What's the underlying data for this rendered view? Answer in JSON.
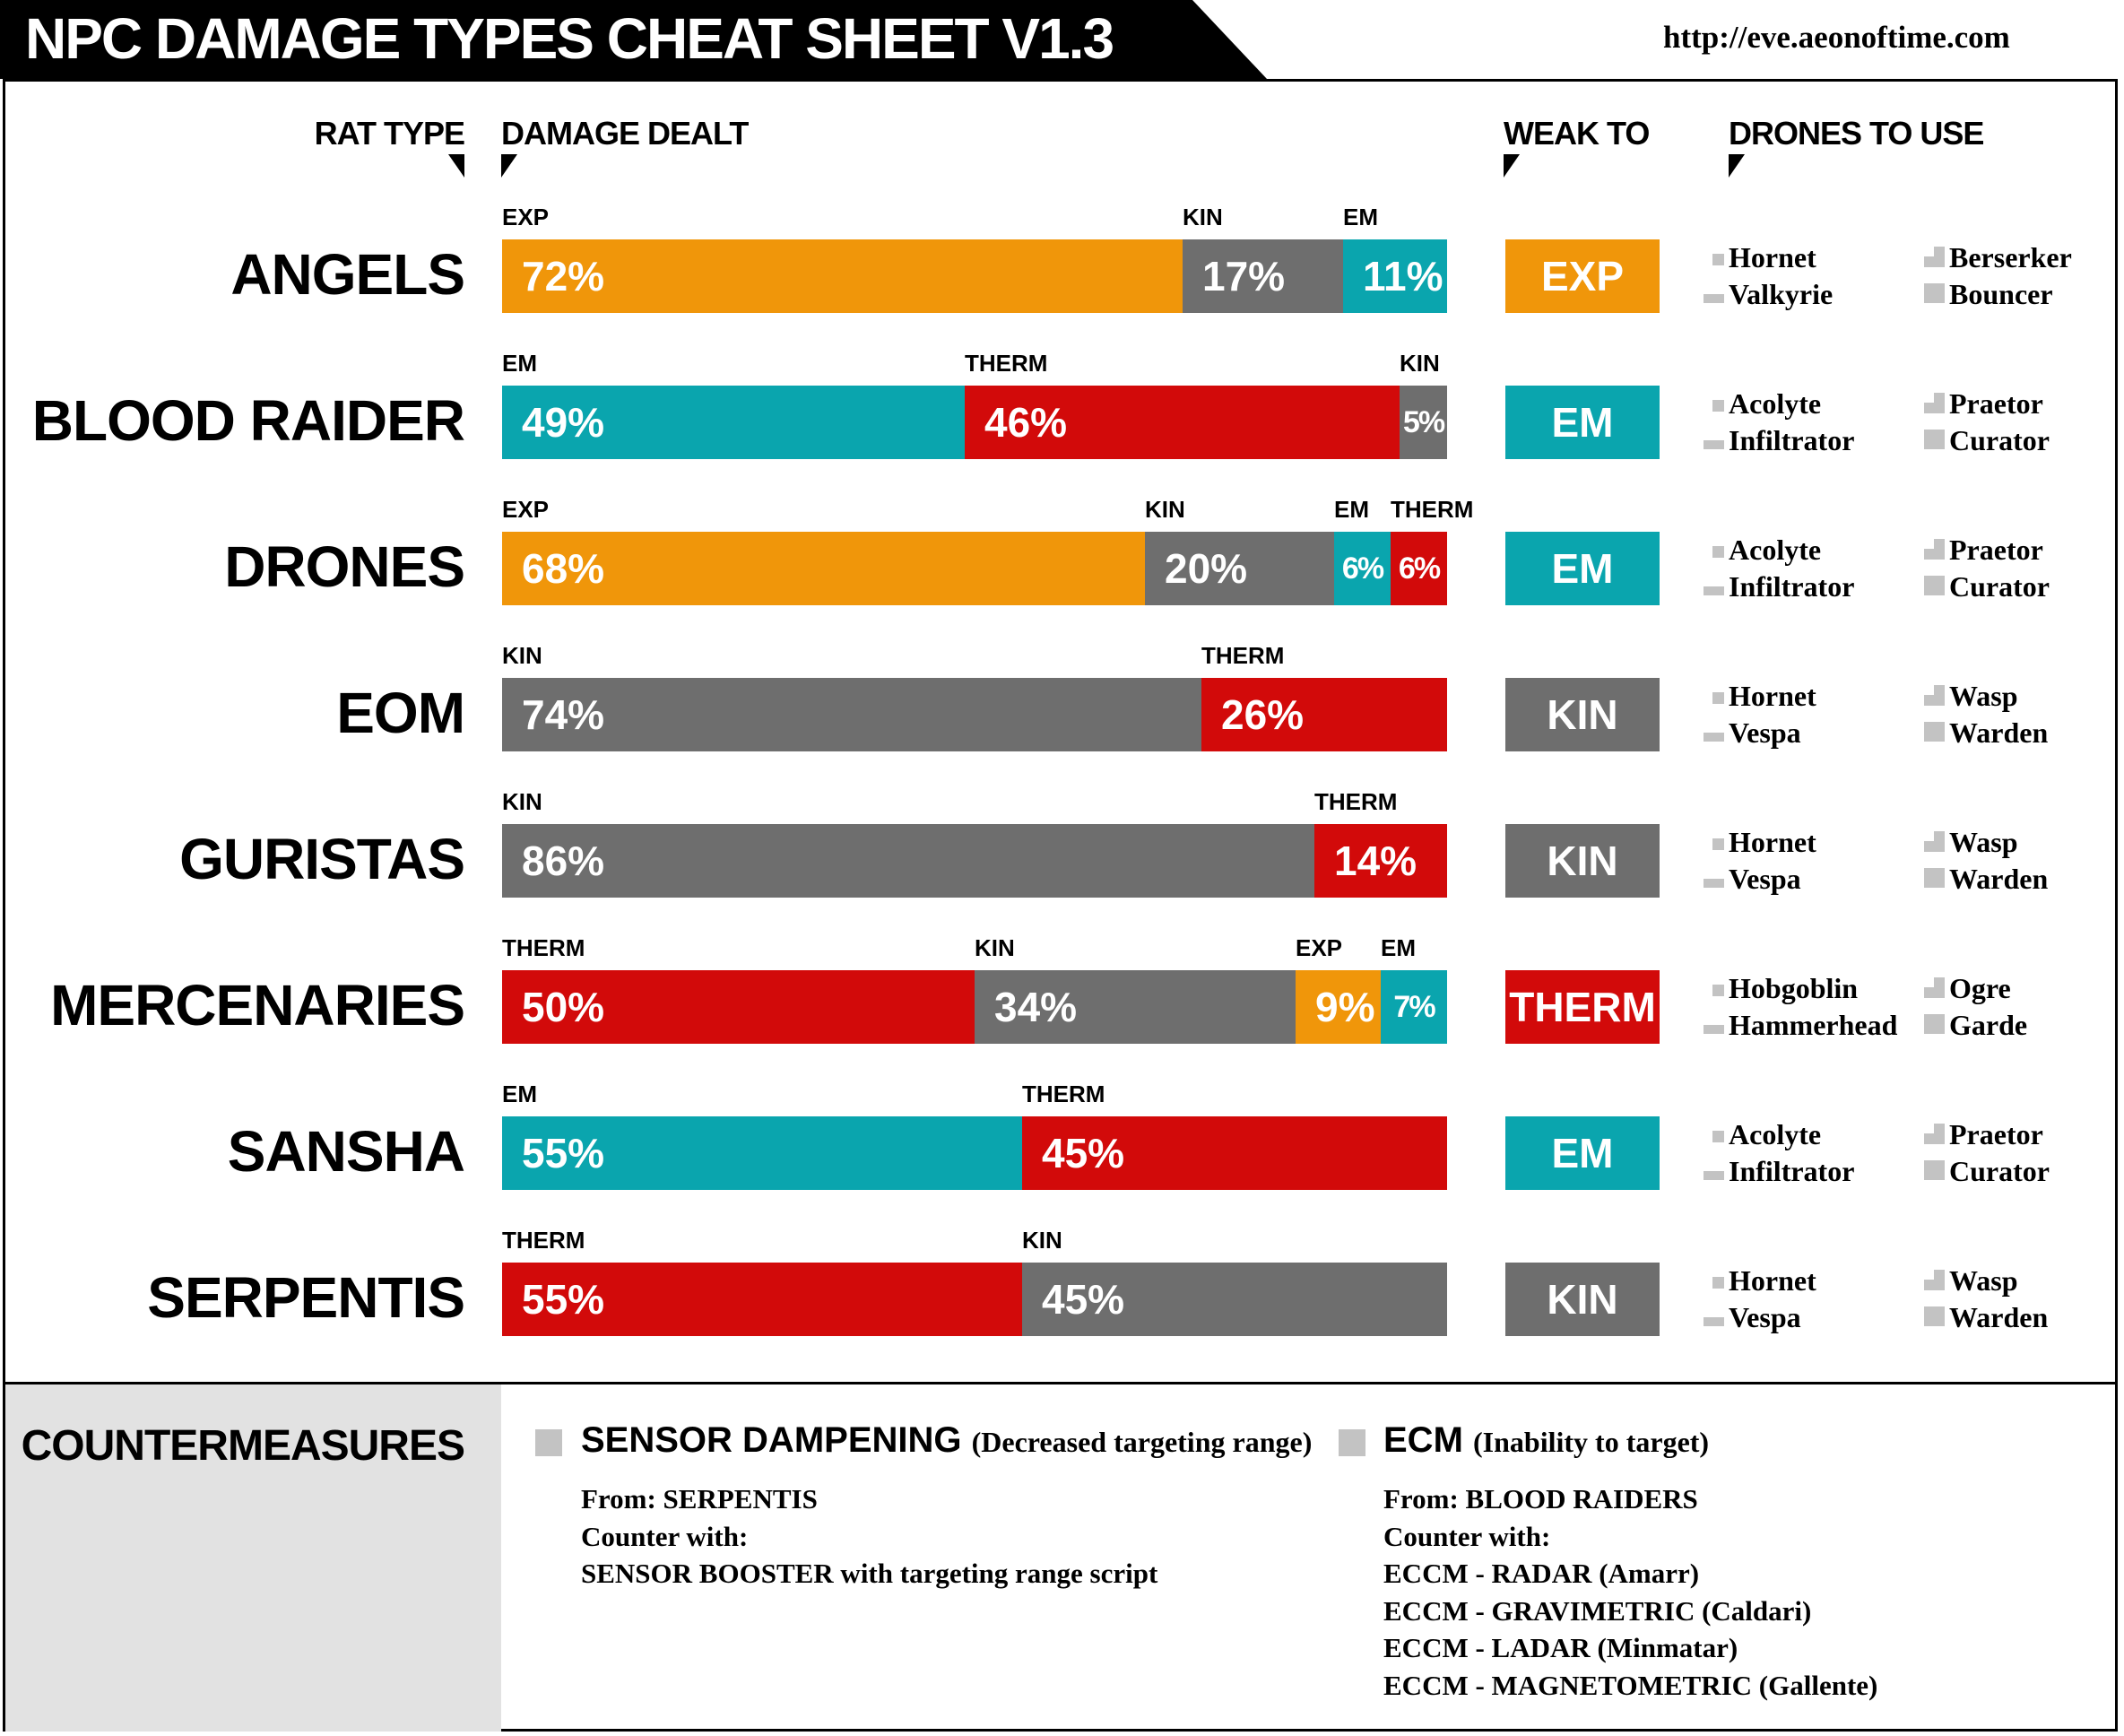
{
  "header": {
    "title": "NPC DAMAGE TYPES CHEAT SHEET V1.3",
    "url": "http://eve.aeonoftime.com"
  },
  "columns": {
    "rat_type": "RAT TYPE",
    "damage_dealt": "DAMAGE DEALT",
    "weak_to": "WEAK TO",
    "drones_to_use": "DRONES TO USE"
  },
  "colors": {
    "EXP": "#f0960a",
    "KIN": "#6e6e6e",
    "EM": "#0aa5ae",
    "THERM": "#d20a0a",
    "drone_icon": "#c3c3c3"
  },
  "chart_data": {
    "type": "bar",
    "stacked": true,
    "orientation": "horizontal",
    "unit": "%",
    "categories": [
      "ANGELS",
      "BLOOD RAIDER",
      "DRONES",
      "EOM",
      "GURISTAS",
      "MERCENARIES",
      "SANSHA",
      "SERPENTIS"
    ],
    "rows": [
      {
        "name": "ANGELS",
        "segments": [
          {
            "type": "EXP",
            "value": 72,
            "label": "72%"
          },
          {
            "type": "KIN",
            "value": 17,
            "label": "17%"
          },
          {
            "type": "EM",
            "value": 11,
            "label": "11%"
          }
        ],
        "weak_to": "EXP",
        "drones": [
          "Hornet",
          "Valkyrie",
          "Berserker",
          "Bouncer"
        ]
      },
      {
        "name": "BLOOD RAIDER",
        "segments": [
          {
            "type": "EM",
            "value": 49,
            "label": "49%"
          },
          {
            "type": "THERM",
            "value": 46,
            "label": "46%"
          },
          {
            "type": "KIN",
            "value": 5,
            "label": "5%"
          }
        ],
        "weak_to": "EM",
        "drones": [
          "Acolyte",
          "Infiltrator",
          "Praetor",
          "Curator"
        ]
      },
      {
        "name": "DRONES",
        "segments": [
          {
            "type": "EXP",
            "value": 68,
            "label": "68%"
          },
          {
            "type": "KIN",
            "value": 20,
            "label": "20%"
          },
          {
            "type": "EM",
            "value": 6,
            "label": "6%"
          },
          {
            "type": "THERM",
            "value": 6,
            "label": "6%"
          }
        ],
        "weak_to": "EM",
        "drones": [
          "Acolyte",
          "Infiltrator",
          "Praetor",
          "Curator"
        ]
      },
      {
        "name": "EOM",
        "segments": [
          {
            "type": "KIN",
            "value": 74,
            "label": "74%"
          },
          {
            "type": "THERM",
            "value": 26,
            "label": "26%"
          }
        ],
        "weak_to": "KIN",
        "drones": [
          "Hornet",
          "Vespa",
          "Wasp",
          "Warden"
        ]
      },
      {
        "name": "GURISTAS",
        "segments": [
          {
            "type": "KIN",
            "value": 86,
            "label": "86%"
          },
          {
            "type": "THERM",
            "value": 14,
            "label": "14%"
          }
        ],
        "weak_to": "KIN",
        "drones": [
          "Hornet",
          "Vespa",
          "Wasp",
          "Warden"
        ]
      },
      {
        "name": "MERCENARIES",
        "segments": [
          {
            "type": "THERM",
            "value": 50,
            "label": "50%"
          },
          {
            "type": "KIN",
            "value": 34,
            "label": "34%"
          },
          {
            "type": "EXP",
            "value": 9,
            "label": "9%"
          },
          {
            "type": "EM",
            "value": 7,
            "label": "7%"
          }
        ],
        "weak_to": "THERM",
        "drones": [
          "Hobgoblin",
          "Hammerhead",
          "Ogre",
          "Garde"
        ]
      },
      {
        "name": "SANSHA",
        "segments": [
          {
            "type": "EM",
            "value": 55,
            "label": "55%"
          },
          {
            "type": "THERM",
            "value": 45,
            "label": "45%"
          }
        ],
        "weak_to": "EM",
        "drones": [
          "Acolyte",
          "Infiltrator",
          "Praetor",
          "Curator"
        ]
      },
      {
        "name": "SERPENTIS",
        "segments": [
          {
            "type": "THERM",
            "value": 55,
            "label": "55%"
          },
          {
            "type": "KIN",
            "value": 45,
            "label": "45%"
          }
        ],
        "weak_to": "KIN",
        "drones": [
          "Hornet",
          "Vespa",
          "Wasp",
          "Warden"
        ]
      }
    ]
  },
  "countermeasures": {
    "title": "COUNTERMEASURES",
    "items": [
      {
        "name": "SENSOR DAMPENING",
        "desc": "(Decreased targeting range)",
        "lines": [
          "From: SERPENTIS",
          "Counter with:",
          "SENSOR BOOSTER with targeting range script"
        ]
      },
      {
        "name": "ECM",
        "desc": "(Inability to target)",
        "lines": [
          "From: BLOOD RAIDERS",
          "Counter with:",
          "ECCM - RADAR (Amarr)",
          "ECCM - GRAVIMETRIC (Caldari)",
          "ECCM - LADAR (Minmatar)",
          "ECCM - MAGNETOMETRIC (Gallente)"
        ]
      }
    ]
  }
}
